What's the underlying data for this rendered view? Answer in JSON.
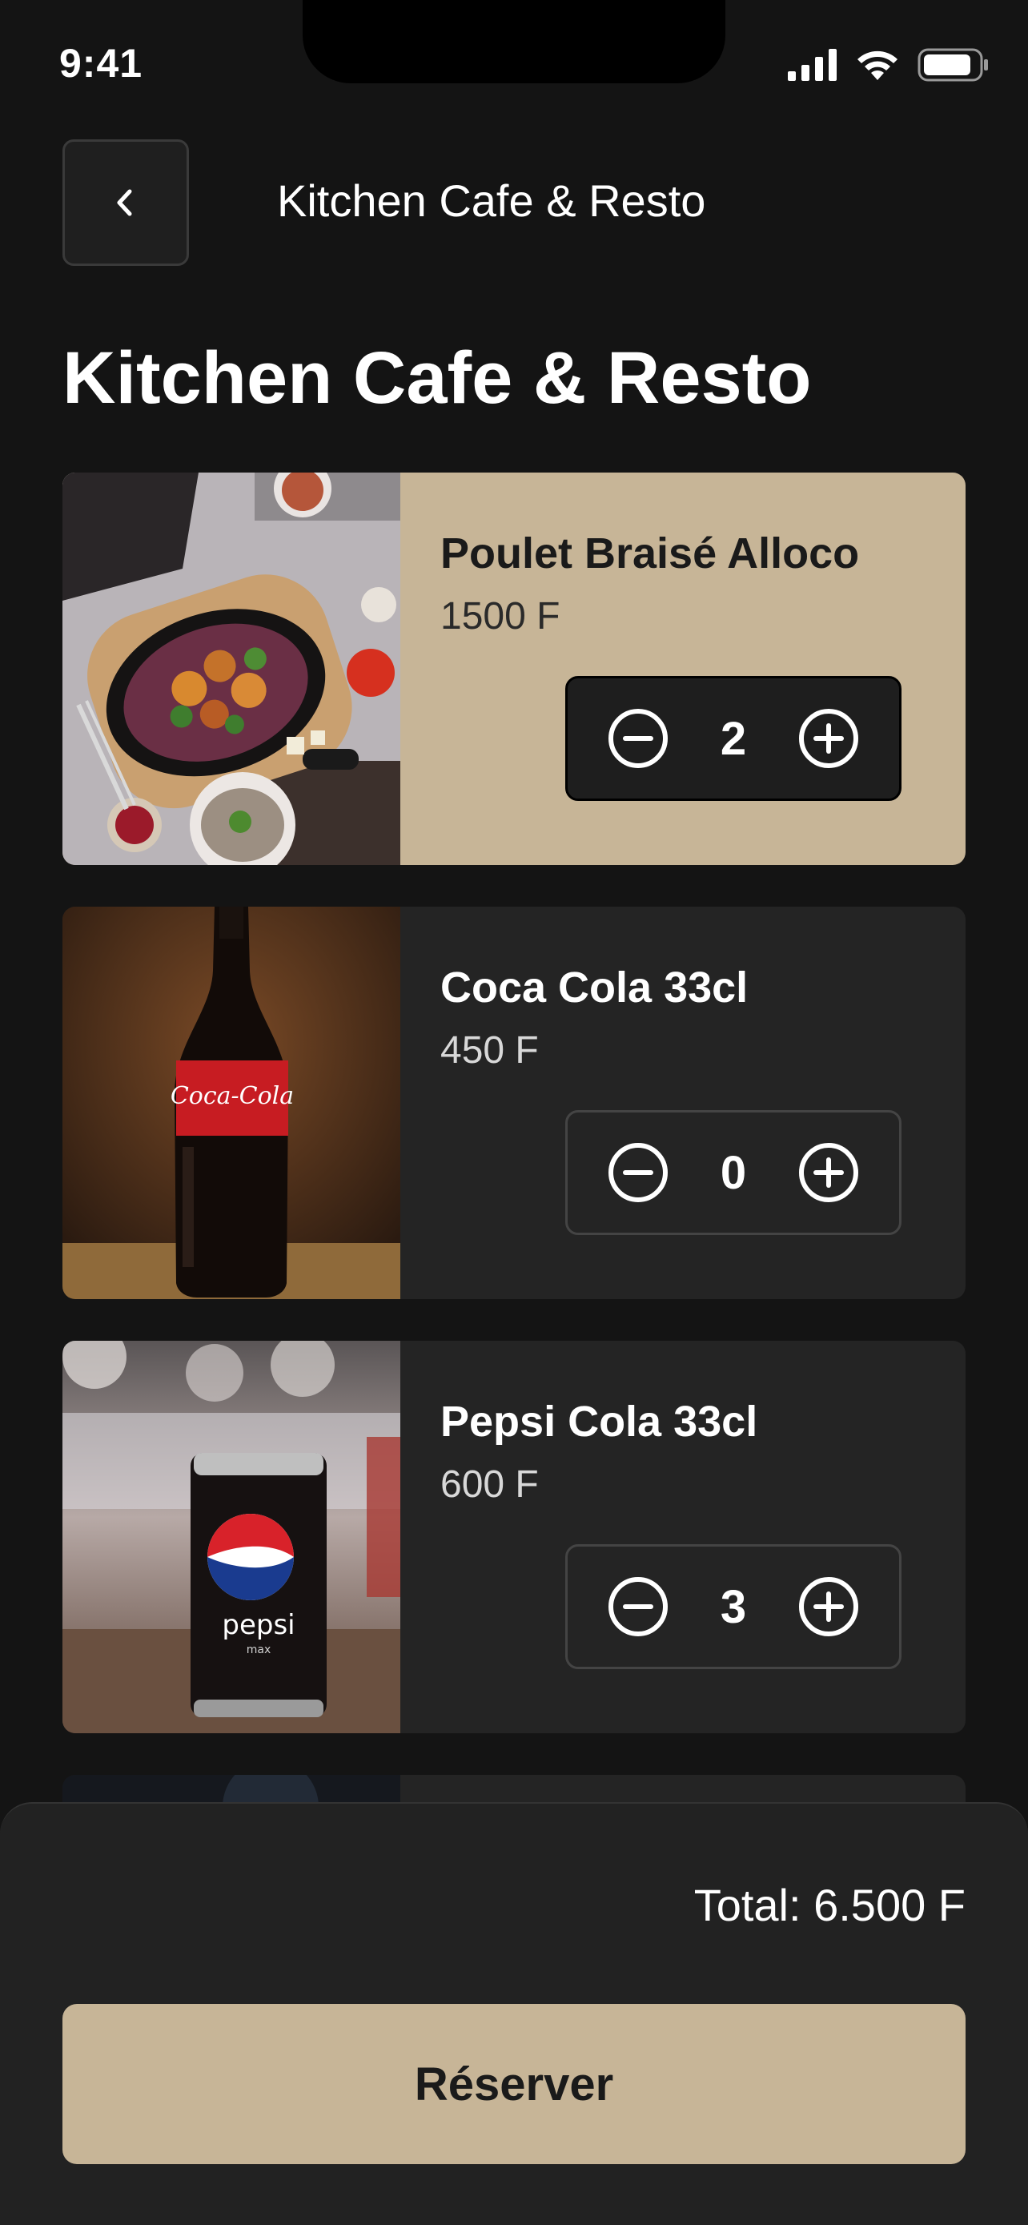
{
  "status_bar": {
    "time": "9:41",
    "icons": [
      "signal-icon",
      "wifi-icon",
      "battery-icon"
    ]
  },
  "header": {
    "back_icon": "chevron-left-icon",
    "title": "Kitchen Cafe & Resto"
  },
  "page": {
    "title": "Kitchen Cafe & Resto"
  },
  "products": [
    {
      "name": "Poulet Braisé Alloco",
      "price": "1500 F",
      "quantity": "2",
      "selected": true
    },
    {
      "name": "Coca Cola 33cl",
      "price": "450 F",
      "quantity": "0",
      "selected": false
    },
    {
      "name": "Pepsi Cola 33cl",
      "price": "600 F",
      "quantity": "3",
      "selected": false
    }
  ],
  "summary": {
    "total": "Total: 6.500 F",
    "reserve_label": "Réserver"
  },
  "colors": {
    "background": "#141414",
    "card": "#242424",
    "accent": "#c7b597",
    "text": "#ffffff"
  }
}
